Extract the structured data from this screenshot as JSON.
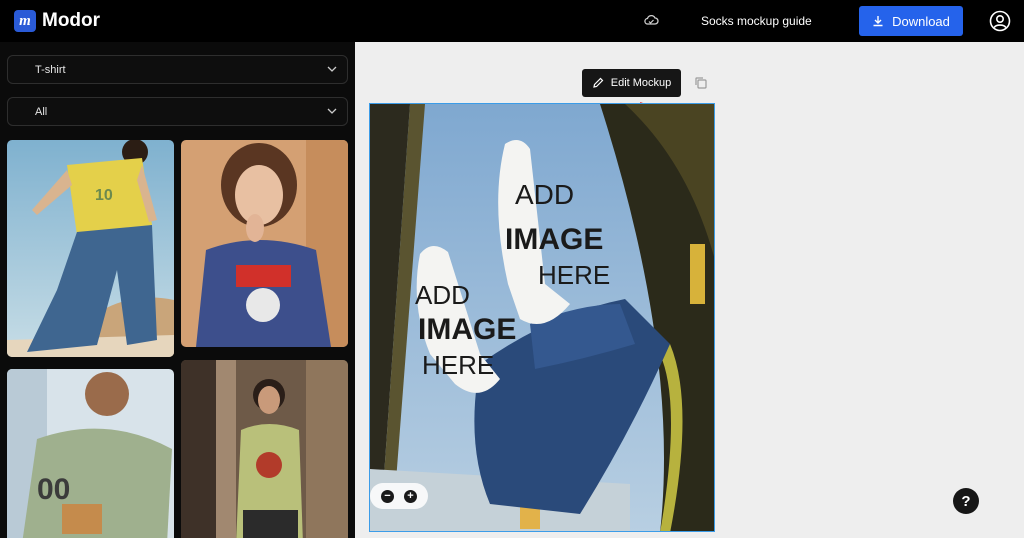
{
  "app": {
    "name": "Modor",
    "logo_letter": "m"
  },
  "header": {
    "document_title": "Socks mockup guide",
    "download_label": "Download",
    "cloud_icon": "cloud-icon",
    "user_icon": "user-circle-icon"
  },
  "sidebar": {
    "category_select": "T-shirt",
    "filter_select": "All",
    "thumbnails": [
      "yellow-tshirt-man-beach",
      "navy-tshirt-woman-astronaut-print",
      "sage-oversized-tshirt-man",
      "olive-tshirt-man-street"
    ]
  },
  "editor": {
    "edit_label": "Edit Mockup",
    "mockup_placeholder": [
      "ADD",
      "IMAGE",
      "HERE"
    ],
    "zoom_out": "−",
    "zoom_in": "+",
    "help": "?"
  },
  "colors": {
    "accent": "#2563eb",
    "selection": "#3b9ce8",
    "annotation_arrow": "#e3141b"
  }
}
